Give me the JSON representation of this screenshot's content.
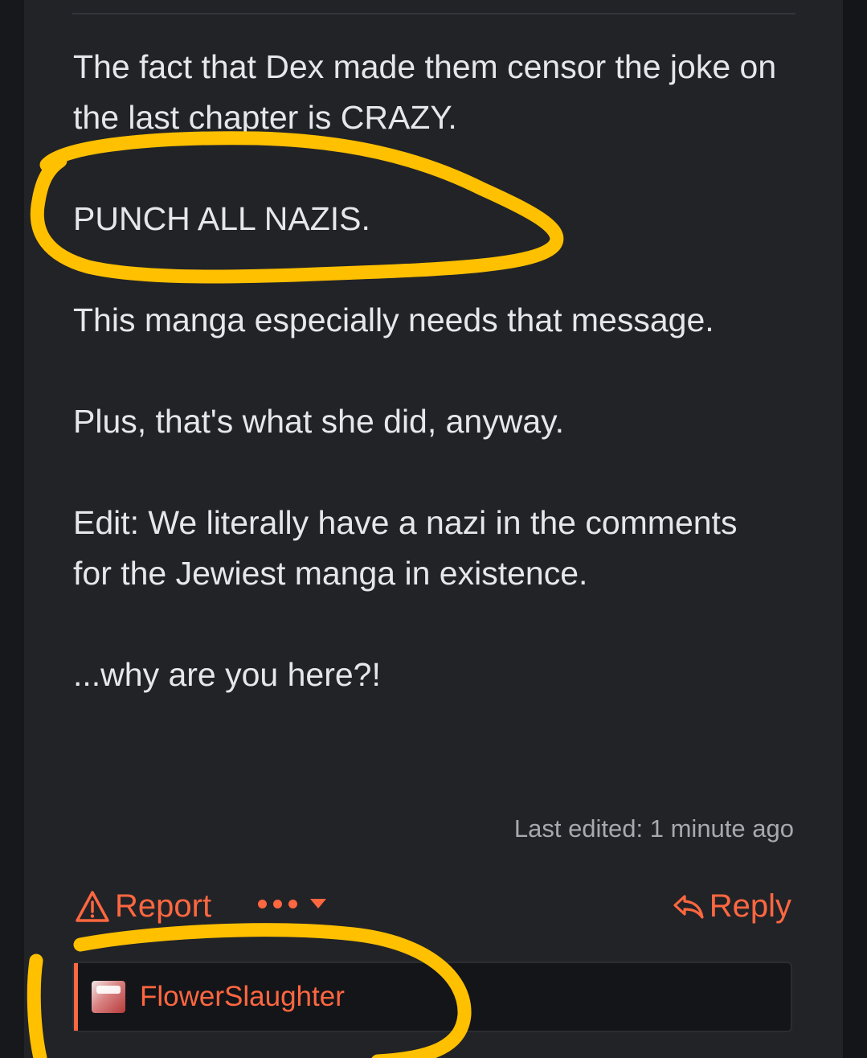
{
  "post": {
    "paragraphs": [
      "The fact that Dex made them censor the joke on the last chapter is CRAZY.",
      "PUNCH ALL NAZIS.",
      "This manga especially needs that message.",
      "Plus, that's what she did, anyway.",
      "Edit: We literally have a nazi in the comments for the Jewiest manga in existence.",
      "...why are you here?!"
    ],
    "last_edited": "Last edited: 1 minute ago"
  },
  "actions": {
    "report_label": "Report",
    "reply_label": "Reply"
  },
  "quote": {
    "username": "FlowerSlaughter"
  },
  "colors": {
    "accent": "#ff6740",
    "highlight": "#ffc000",
    "panel": "#222327"
  },
  "icons": {
    "report": "warning-triangle-icon",
    "more": "more-dots-icon",
    "dropdown": "caret-down-icon",
    "reply": "reply-arrow-icon"
  }
}
